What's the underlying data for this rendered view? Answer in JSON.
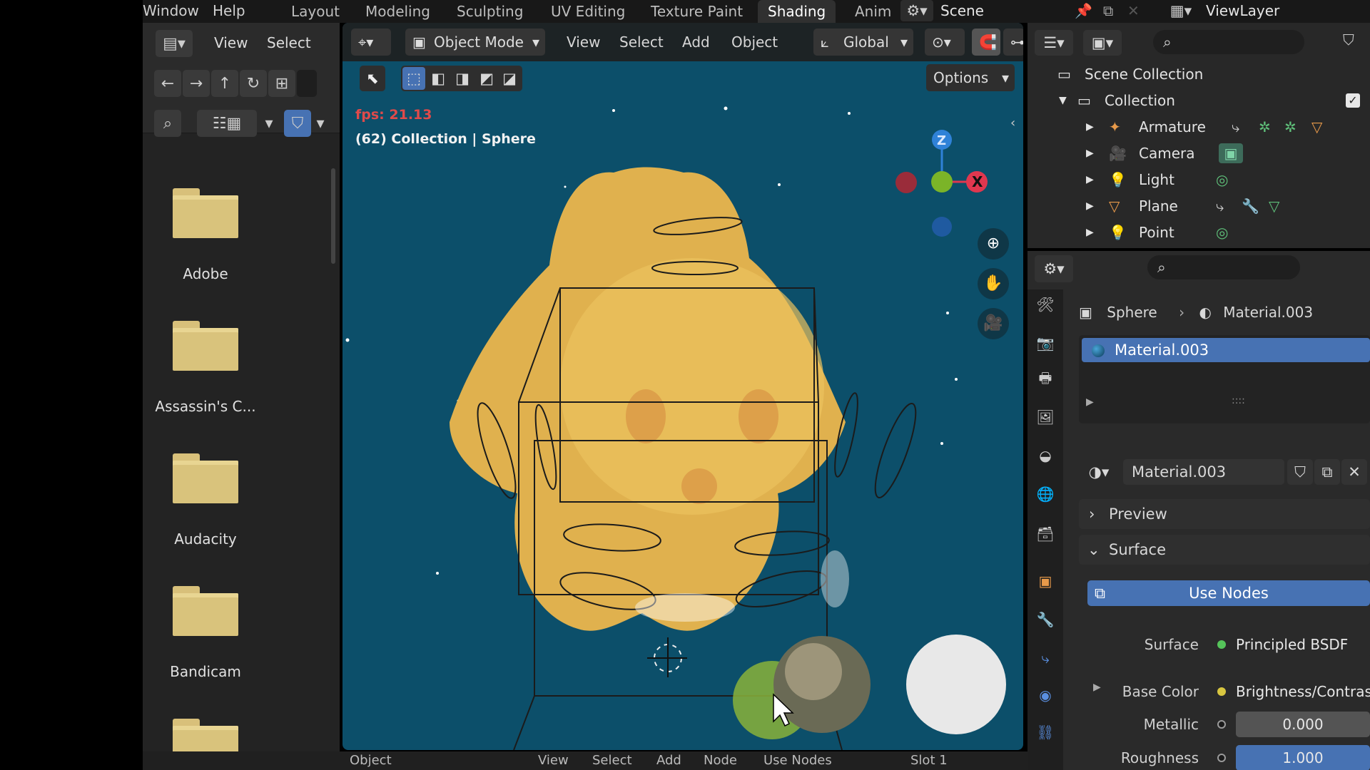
{
  "menubar": {
    "window": "Window",
    "help": "Help"
  },
  "workspaces": [
    "Layout",
    "Modeling",
    "Sculpting",
    "UV Editing",
    "Texture Paint",
    "Shading",
    "Anim"
  ],
  "scene": {
    "scene_name": "Scene",
    "view_layer": "ViewLayer"
  },
  "filebrowser": {
    "view": "View",
    "select": "Select",
    "folders": [
      "Adobe",
      "Assassin's C...",
      "Audacity",
      "Bandicam",
      ""
    ]
  },
  "viewport": {
    "mode": "Object Mode",
    "menus": [
      "View",
      "Select",
      "Add",
      "Object"
    ],
    "transform": "Global",
    "options": "Options",
    "fps": "fps: 21.13",
    "info": "(62) Collection | Sphere",
    "axis_x": "X",
    "axis_z": "Z",
    "bottom_items": [
      "Object",
      "View",
      "Select",
      "Add",
      "Node",
      "Use Nodes",
      "Slot 1"
    ]
  },
  "outliner": {
    "root": "Scene Collection",
    "collection": "Collection",
    "items": [
      "Armature",
      "Camera",
      "Light",
      "Plane",
      "Point"
    ]
  },
  "properties": {
    "object": "Sphere",
    "material": "Material.003",
    "slot_material": "Material.003",
    "datablock": "Material.003",
    "preview": "Preview",
    "surface_panel": "Surface",
    "use_nodes": "Use Nodes",
    "fields": [
      {
        "label": "Surface",
        "value": "Principled BSDF",
        "dot": "#55c45a"
      },
      {
        "label": "Base Color",
        "value": "Brightness/Contras",
        "dot": "#d8c640"
      },
      {
        "label": "Metallic",
        "value": "0.000",
        "dot": "#9a9a9a"
      },
      {
        "label": "Roughness",
        "value": "1.000",
        "dot": "#9a9a9a"
      }
    ],
    "roughness_level": 1.0
  },
  "colors": {
    "accent": "#4772b3",
    "viewport_bg": "#0c4f6a",
    "character": "#e8b54e",
    "axis_x": "#e0374f",
    "axis_y": "#7bb428",
    "axis_z": "#2f82d8"
  }
}
